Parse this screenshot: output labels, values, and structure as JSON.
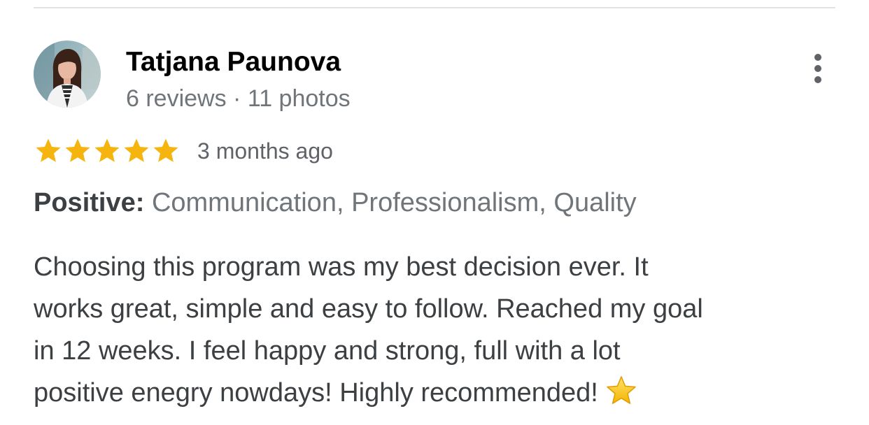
{
  "review": {
    "reviewer": {
      "name": "Tatjana Paunova",
      "meta": "6 reviews · 11 photos"
    },
    "rating": 5,
    "max_rating": 5,
    "date": "3 months ago",
    "positive": {
      "label": "Positive:",
      "values": "Communication, Professionalism, Quality"
    },
    "text_lines": [
      "Choosing this program was my best decision ever. It",
      "works great, simple and easy to follow. Reached my goal",
      "in 12 weeks. I feel happy and strong, full with a lot",
      "positive enegry nowdays! Highly recommended!"
    ],
    "more_icon": "more-vert-icon",
    "star_color": "#f6b40e"
  }
}
